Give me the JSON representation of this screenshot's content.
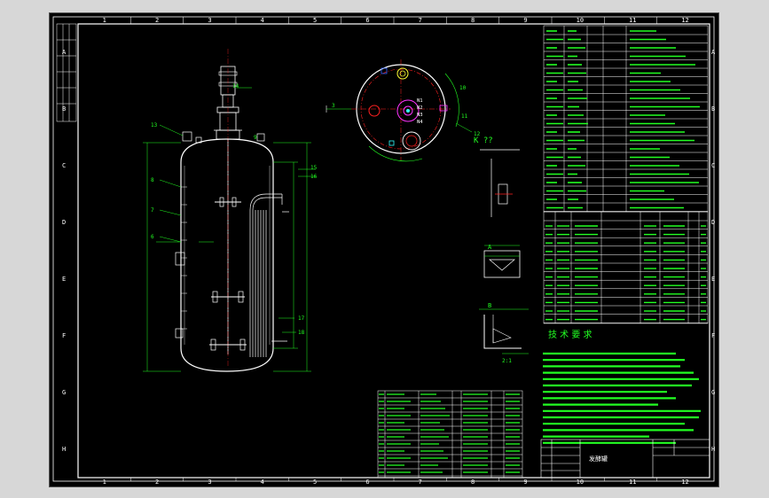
{
  "drawing": {
    "title_cn": "发酵罐",
    "tech_heading": "技 术 要 求",
    "view_label_k": "K ??",
    "section_a_label": "A",
    "section_b_label": "B",
    "scale_label": "2:1"
  },
  "grid": {
    "columns": [
      "1",
      "2",
      "3",
      "4",
      "5",
      "6",
      "7",
      "8",
      "9",
      "10",
      "11",
      "12"
    ],
    "rows": [
      "A",
      "B",
      "C",
      "D",
      "E",
      "F",
      "G",
      "H"
    ]
  },
  "callouts": {
    "c14": "14",
    "c13": "13",
    "c15": "15",
    "c16": "16",
    "c17": "17",
    "c18": "18",
    "c19": "19",
    "c8": "8",
    "c7": "7",
    "c6": "6",
    "c5": "5",
    "c4": "4",
    "c3": "3",
    "c9": "9",
    "c10": "10",
    "c11": "11",
    "c12": "12",
    "cn1": "N1",
    "cn2": "N2",
    "cn3": "N3",
    "cn4": "N4"
  },
  "colors": {
    "green": "#22ff22",
    "white": "#ffffff",
    "red": "#ff2020",
    "magenta": "#ff33ff",
    "cyan": "#33ffff",
    "yellow": "#ffff33",
    "blue": "#3366ff"
  }
}
